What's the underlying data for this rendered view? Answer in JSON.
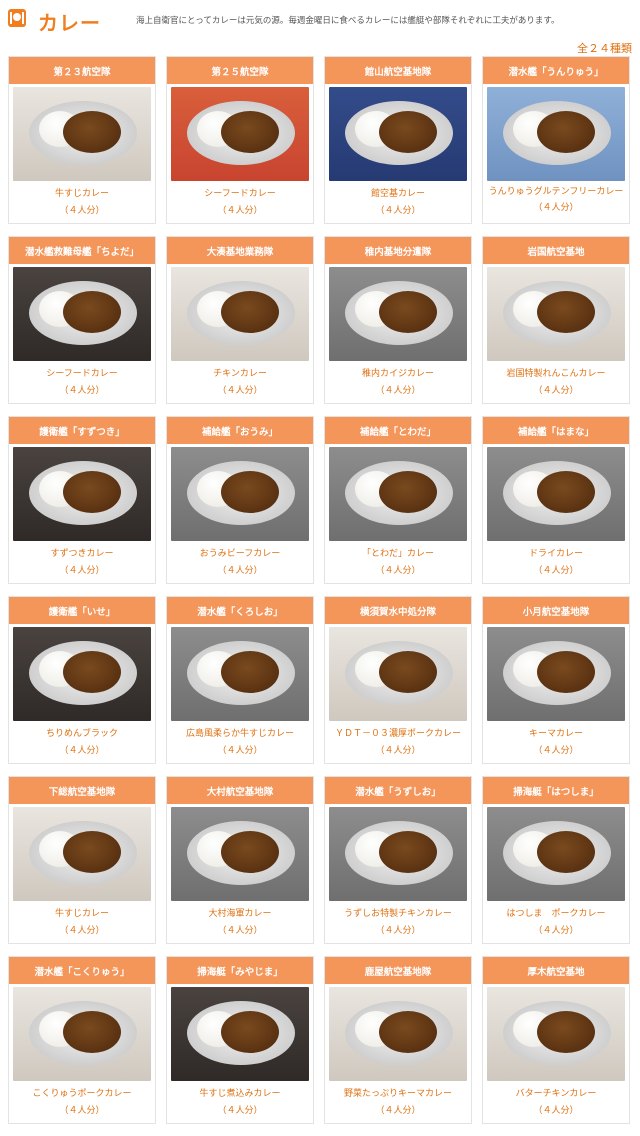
{
  "header": {
    "title": "カレー",
    "intro": "海上自衛官にとってカレーは元気の源。毎週金曜日に食べるカレーには艦艇や部隊それぞれに工夫があります。",
    "count": "全２４種類"
  },
  "items": [
    {
      "unit": "第２３航空隊",
      "dish": "牛すじカレー",
      "serving": "（４人分）"
    },
    {
      "unit": "第２５航空隊",
      "dish": "シーフードカレー",
      "serving": "（４人分）"
    },
    {
      "unit": "館山航空基地隊",
      "dish": "館空基カレー",
      "serving": "（４人分）"
    },
    {
      "unit": "潜水艦「うんりゅう」",
      "dish": "うんりゅうグルテンフリーカレー",
      "serving": "（４人分）"
    },
    {
      "unit": "潜水艦救難母艦「ちよだ」",
      "dish": "シーフードカレー",
      "serving": "（４人分）"
    },
    {
      "unit": "大湊基地業務隊",
      "dish": "チキンカレー",
      "serving": "（４人分）"
    },
    {
      "unit": "稚内基地分遣隊",
      "dish": "稚内カイジカレー",
      "serving": "（４人分）"
    },
    {
      "unit": "岩国航空基地",
      "dish": "岩国特製れんこんカレー",
      "serving": "（４人分）"
    },
    {
      "unit": "護衛艦「すずつき」",
      "dish": "すずつきカレー",
      "serving": "（４人分）"
    },
    {
      "unit": "補給艦「おうみ」",
      "dish": "おうみビーフカレー",
      "serving": "（４人分）"
    },
    {
      "unit": "補給艦「とわだ」",
      "dish": "「とわだ」カレー",
      "serving": "（４人分）"
    },
    {
      "unit": "補給艦「はまな」",
      "dish": "ドライカレー",
      "serving": "（４人分）"
    },
    {
      "unit": "護衛艦「いせ」",
      "dish": "ちりめんブラック",
      "serving": "（４人分）"
    },
    {
      "unit": "潜水艦「くろしお」",
      "dish": "広島風柔らか牛すじカレー",
      "serving": "（４人分）"
    },
    {
      "unit": "横須賀水中処分隊",
      "dish": "ＹＤＴ－０３濃厚ポークカレー",
      "serving": "（４人分）"
    },
    {
      "unit": "小月航空基地隊",
      "dish": "キーマカレー",
      "serving": "（４人分）"
    },
    {
      "unit": "下総航空基地隊",
      "dish": "牛すじカレー",
      "serving": "（４人分）"
    },
    {
      "unit": "大村航空基地隊",
      "dish": "大村海軍カレー",
      "serving": "（４人分）"
    },
    {
      "unit": "潜水艦「うずしお」",
      "dish": "うずしお特製チキンカレー",
      "serving": "（４人分）"
    },
    {
      "unit": "掃海艇「はつしま」",
      "dish": "はつしま　ポークカレー",
      "serving": "（４人分）"
    },
    {
      "unit": "潜水艦「こくりゅう」",
      "dish": "こくりゅうポークカレー",
      "serving": "（４人分）"
    },
    {
      "unit": "掃海艇「みやじま」",
      "dish": "牛すじ煮込みカレー",
      "serving": "（４人分）"
    },
    {
      "unit": "鹿屋航空基地隊",
      "dish": "野菜たっぷりキーマカレー",
      "serving": "（４人分）"
    },
    {
      "unit": "厚木航空基地",
      "dish": "バターチキンカレー",
      "serving": "（４人分）"
    }
  ]
}
